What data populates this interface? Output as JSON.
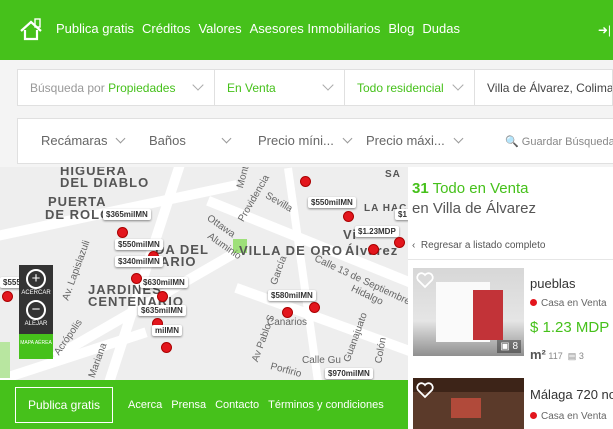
{
  "nav": {
    "links": [
      "Publica gratis",
      "Créditos",
      "Valores",
      "Asesores Inmobiliarios",
      "Blog",
      "Dudas"
    ]
  },
  "search": {
    "property_prefix": "Búsqueda por ",
    "property_type": "Propiedades",
    "operation": "En Venta",
    "category": "Todo residencial",
    "location": "Villa de Álvarez, Colima"
  },
  "filters": {
    "bedrooms": "Recámaras",
    "bathrooms": "Baños",
    "price_min": "Precio míni...",
    "price_max": "Precio máxi...",
    "save_search": "Guardar Búsqueda"
  },
  "map": {
    "labels": {
      "higuera": "HIGUERA",
      "diablo": "DEL DIABLO",
      "puerta": "PUERTA",
      "rolon": "DE ROLON",
      "villa_oro": "VILLA DE ORO",
      "jardines": "JARDINES",
      "centenario": "CENTENARIO",
      "lapiazuli": "Av. Lapislazuli",
      "ottawa": "Ottawa",
      "aluminio": "Aluminio",
      "sevilla": "Sevilla",
      "providencia": "Providencia",
      "monte": "Monte",
      "calle13": "Calle 13 de Septiembre",
      "hidalgo": "Hidalgo",
      "guanajuato": "Guanajuato",
      "canarios": "Canarios",
      "acropolis": "Acrópolis",
      "av_pablo": "Av Pablo S",
      "garcia": "García",
      "colon": "Colón",
      "mariana": "Mariana",
      "calle_gu": "Calle Gu",
      "porfirio": "Porfirio",
      "alvarez": "Álvarez",
      "lahac": "LA HAC",
      "villa": "Vi",
      "da_del": "DA DEL",
      "ario": "ARIO",
      "sa": "SA"
    },
    "prices": [
      "$365milMN",
      "$550milMN",
      "$340milMN",
      "$630milMN",
      "$635milMN",
      "$580milMN",
      "$550milMN",
      "$1.23MDP",
      "$970milMN",
      "$555",
      "milMN",
      "$1"
    ],
    "zoom_in_label": "ACERCAR",
    "zoom_out_label": "ALEJAR",
    "map_toggle": "MAPA AÉREA"
  },
  "footer": {
    "publish": "Publica gratis",
    "links": [
      "Acerca",
      "Prensa",
      "Contacto",
      "Términos y condiciones"
    ]
  },
  "results": {
    "count": "31",
    "count_suffix": " Todo en Venta",
    "location": "en Villa de Álvarez",
    "back": "Regresar a listado completo",
    "cards": [
      {
        "title": "pueblas",
        "type": "Casa en Venta",
        "price": "$ 1.23 MDP",
        "area": "117",
        "beds": "3",
        "photos": "8"
      },
      {
        "title": "Málaga 720 no",
        "type": "Casa en Venta"
      }
    ]
  },
  "colors": {
    "brand_green": "#46c11b",
    "pin_red": "#e3161d"
  }
}
